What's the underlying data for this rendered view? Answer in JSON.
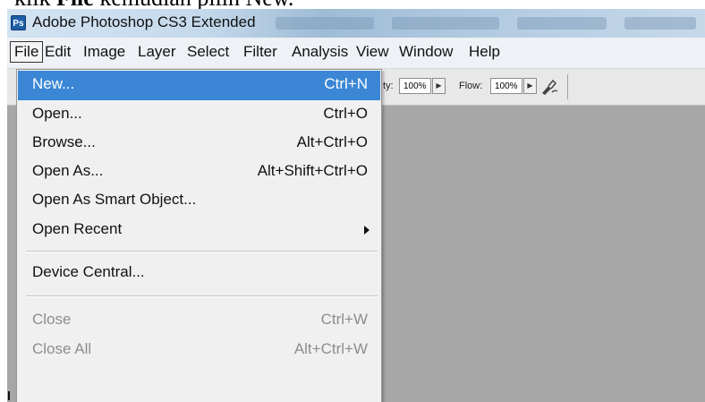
{
  "caption": {
    "prefix": "klik ",
    "bold": "File",
    "suffix": " kemudian pilih New."
  },
  "window": {
    "app_icon_text": "Ps",
    "title": "Adobe Photoshop CS3 Extended"
  },
  "menubar": {
    "items": [
      "File",
      "Edit",
      "Image",
      "Layer",
      "Select",
      "Filter",
      "Analysis",
      "View",
      "Window",
      "Help"
    ]
  },
  "options_bar": {
    "opacity_label": "ty:",
    "opacity_value": "100%",
    "flow_label": "Flow:",
    "flow_value": "100%",
    "arrow_glyph": "▶"
  },
  "file_menu": {
    "items": [
      {
        "label": "New...",
        "shortcut": "Ctrl+N"
      },
      {
        "label": "Open...",
        "shortcut": "Ctrl+O"
      },
      {
        "label": "Browse...",
        "shortcut": "Alt+Ctrl+O"
      },
      {
        "label": "Open As...",
        "shortcut": "Alt+Shift+Ctrl+O"
      },
      {
        "label": "Open As Smart Object...",
        "shortcut": ""
      },
      {
        "label": "Open Recent",
        "shortcut": ""
      },
      {
        "label": "Device Central...",
        "shortcut": ""
      },
      {
        "label": "Close",
        "shortcut": "Ctrl+W"
      },
      {
        "label": "Close All",
        "shortcut": "Alt+Ctrl+W"
      }
    ]
  },
  "colors": {
    "highlight": "#3b87d6",
    "canvas": "#a7a7a7",
    "menubar": "#eef1f5"
  }
}
